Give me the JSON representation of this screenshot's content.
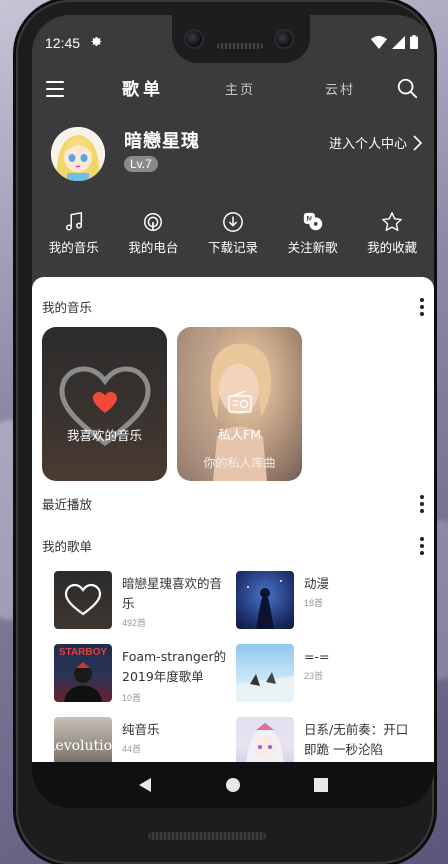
{
  "status_bar": {
    "time": "12:45",
    "settings_icon": "gear-icon",
    "icons": [
      "wifi-icon",
      "signal-icon",
      "battery-icon"
    ]
  },
  "top_bar": {
    "menu_icon": "hamburger-menu-icon",
    "tabs": [
      {
        "label": "歌单",
        "active": true
      },
      {
        "label": "主页",
        "active": false
      },
      {
        "label": "云村",
        "active": false
      }
    ],
    "search_icon": "search-icon"
  },
  "profile": {
    "username": "暗戀星瑰",
    "level": "Lv.7",
    "center_link": "进入个人中心"
  },
  "quick_actions": [
    {
      "label": "我的音乐",
      "icon": "music-note-icon"
    },
    {
      "label": "我的电台",
      "icon": "podcast-icon"
    },
    {
      "label": "下载记录",
      "icon": "download-icon"
    },
    {
      "label": "关注新歌",
      "icon": "new-song-icon"
    },
    {
      "label": "我的收藏",
      "icon": "star-icon"
    }
  ],
  "my_music": {
    "title": "我的音乐",
    "cards": [
      {
        "label": "我喜欢的音乐",
        "sub": ""
      },
      {
        "label": "私人FM",
        "sub": "你的私人库曲"
      }
    ]
  },
  "recent": {
    "title": "最近播放"
  },
  "my_playlists": {
    "title": "我的歌单",
    "items": [
      {
        "name": "暗戀星瑰喜欢的音乐",
        "count": "492首"
      },
      {
        "name": "动漫",
        "count": "18首"
      },
      {
        "name": "Foam-stranger的2019年度歌单",
        "count": "10首"
      },
      {
        "name": "=-=",
        "count": "23首"
      },
      {
        "name": "纯音乐",
        "count": "44首"
      },
      {
        "name": "日系/无前奏：开口即跪 一秒沦陷",
        "count": ""
      }
    ]
  },
  "colors": {
    "header_bg": "#3b3b3d",
    "heart_red": "#f0493a",
    "panel_bg": "#ffffff"
  }
}
